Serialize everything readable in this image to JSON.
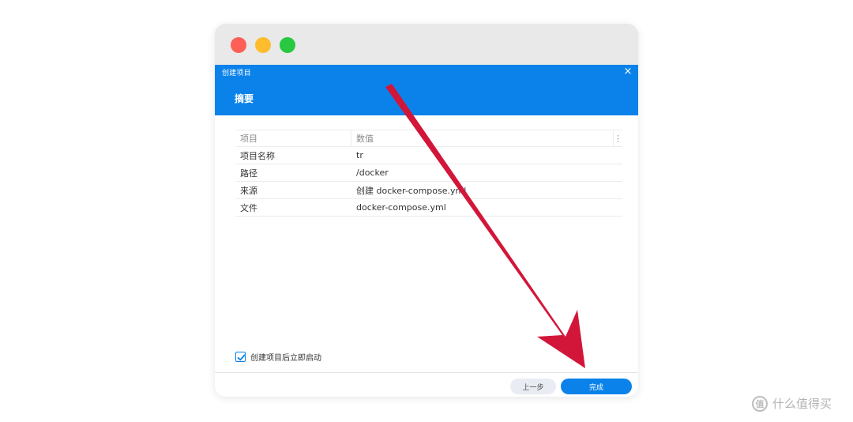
{
  "window": {
    "traffic_lights": {
      "close_color": "#fe5f57",
      "minimize_color": "#febc2e",
      "zoom_color": "#28c840"
    }
  },
  "dialog": {
    "title": "创建项目",
    "close_glyph": "×",
    "step_title": "摘要",
    "header_color": "#0a82ea"
  },
  "table": {
    "headers": {
      "key": "项目",
      "value": "数值",
      "menu": "⋮"
    },
    "rows": [
      {
        "key": "项目名称",
        "value": "tr"
      },
      {
        "key": "路径",
        "value": "/docker"
      },
      {
        "key": "来源",
        "value": "创建 docker-compose.yml"
      },
      {
        "key": "文件",
        "value": "docker-compose.yml"
      }
    ]
  },
  "options": {
    "start_after_create_label": "创建项目后立即启动",
    "start_after_create_checked": true
  },
  "footer": {
    "prev_label": "上一步",
    "done_label": "完成"
  },
  "annotation": {
    "arrow_color": "#d2163a"
  },
  "watermark": {
    "logo_glyph": "值",
    "text": "什么值得买"
  }
}
